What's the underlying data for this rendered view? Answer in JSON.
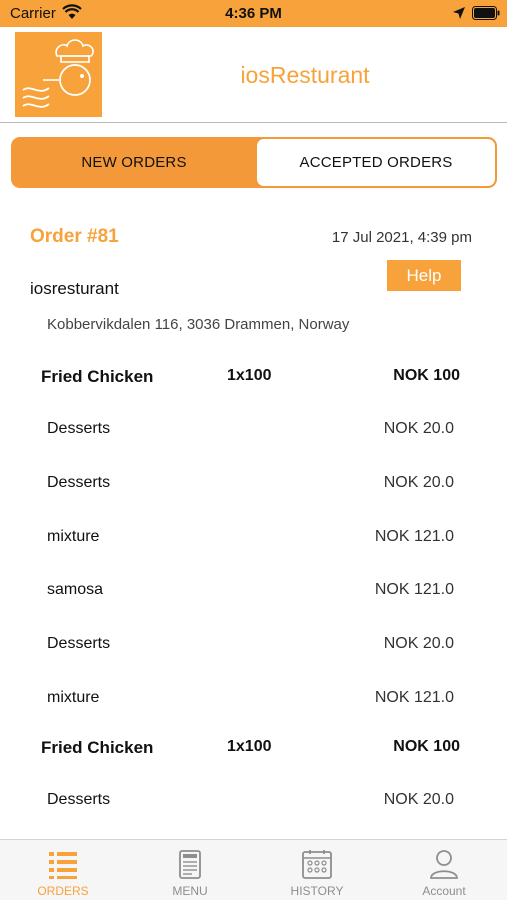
{
  "status_bar": {
    "carrier": "Carrier",
    "time": "4:36 PM"
  },
  "header": {
    "title": "iosResturant"
  },
  "segments": {
    "new_orders": "NEW ORDERS",
    "accepted_orders": "ACCEPTED ORDERS"
  },
  "order": {
    "number": "Order #81",
    "date": "17 Jul 2021, 4:39 pm",
    "help_label": "Help",
    "restaurant_name": "iosresturant",
    "address": "Kobbervikdalen 116, 3036 Drammen, Norway",
    "rows": [
      {
        "name": "Fried Chicken",
        "qty": "1x100",
        "price": "NOK 100"
      },
      {
        "name": "Desserts",
        "price": "NOK 20.0"
      },
      {
        "name": "Desserts",
        "price": "NOK 20.0"
      },
      {
        "name": "mixture",
        "price": "NOK 121.0"
      },
      {
        "name": "samosa",
        "price": "NOK 121.0"
      },
      {
        "name": "Desserts",
        "price": "NOK 20.0"
      },
      {
        "name": "mixture",
        "price": "NOK 121.0"
      },
      {
        "name": "Fried Chicken",
        "qty": "1x100",
        "price": "NOK 100"
      },
      {
        "name": "Desserts",
        "price": "NOK 20.0"
      }
    ]
  },
  "tabs": [
    {
      "label": "ORDERS",
      "icon": "orders-list-icon",
      "active": true
    },
    {
      "label": "MENU",
      "icon": "menu-card-icon",
      "active": false
    },
    {
      "label": "HISTORY",
      "icon": "history-calendar-icon",
      "active": false
    },
    {
      "label": "Account",
      "icon": "account-person-icon",
      "active": false
    }
  ],
  "colors": {
    "accent": "#f7a23a",
    "tab_inactive": "#8e8e8e"
  }
}
